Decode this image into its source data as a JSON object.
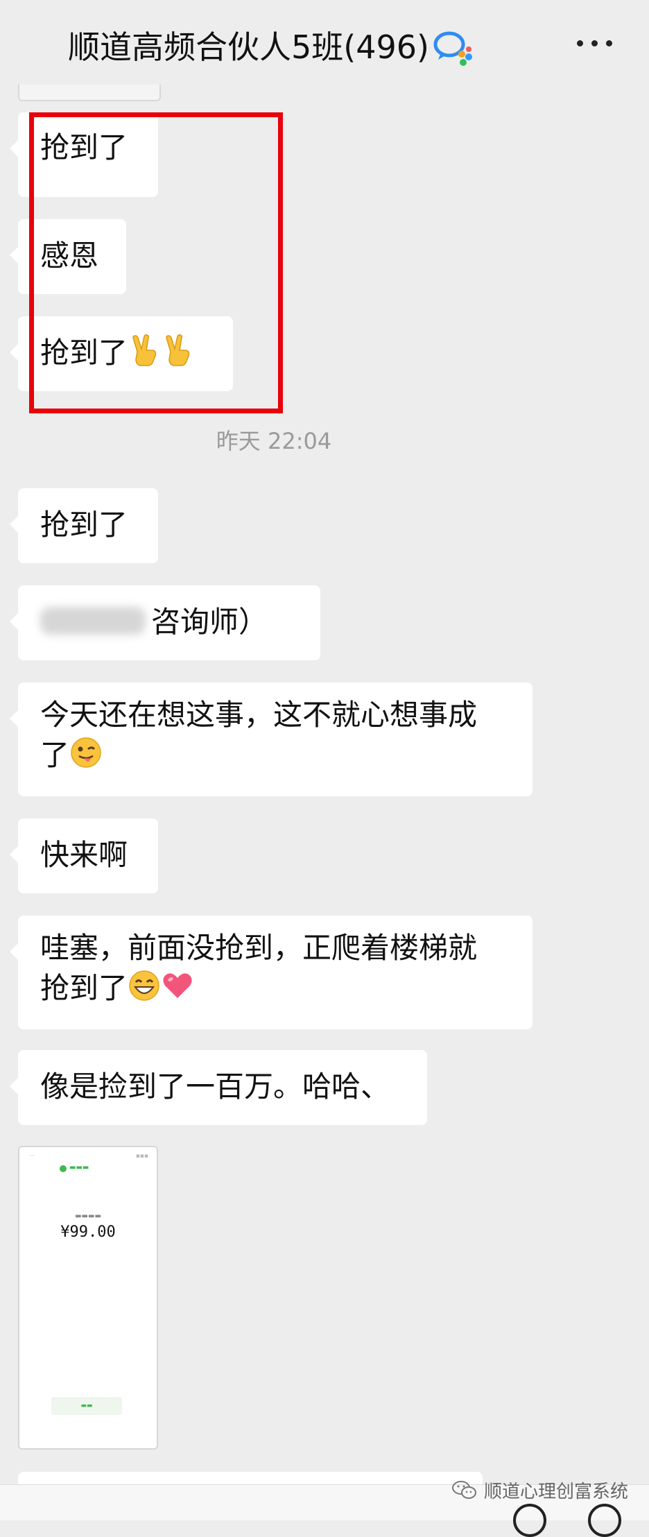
{
  "header": {
    "title": "顺道高频合伙人5班(496)",
    "icon": "wecom-chat-icon",
    "more_icon": "more-dots-icon"
  },
  "messages_highlighted": [
    {
      "text": "抢到了"
    },
    {
      "text": "感恩"
    },
    {
      "text": "抢到了",
      "emoji": [
        "victory-hand-emoji",
        "victory-hand-emoji"
      ]
    }
  ],
  "timestamp": "昨天 22:04",
  "messages": [
    {
      "text": "抢到了"
    },
    {
      "mention_suffix": "咨询师）",
      "mention_blurred": true
    },
    {
      "line1": "今天还在想这事，这不就心想事成",
      "line2": "了",
      "emoji": "winking-tongue-emoji"
    },
    {
      "text": "快来啊"
    },
    {
      "line1": "哇塞，前面没抢到，正爬着楼梯就",
      "line2": "抢到了",
      "emoji": [
        "grinning-emoji",
        "pink-heart-emoji"
      ]
    },
    {
      "text": "像是捡到了一百万。哈哈、"
    }
  ],
  "payment_screenshot": {
    "amount": "¥99.00"
  },
  "watermark": {
    "text": "顺道心理创富系统",
    "icon": "wechat-icon"
  },
  "colors": {
    "background": "#ededed",
    "bubble": "#ffffff",
    "highlight": "#e8000b",
    "timestamp": "#9a9a9a"
  }
}
